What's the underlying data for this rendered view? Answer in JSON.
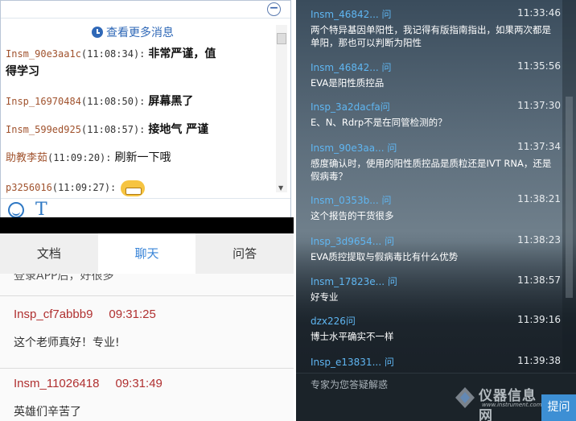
{
  "panel_a": {
    "more_messages": "查看更多消息",
    "messages": [
      {
        "user": "Insm_90e3aa1c",
        "time": "(11:08:34):",
        "text": "非常严谨，值",
        "text2": "得学习"
      },
      {
        "user": "Insp_16970484",
        "time": "(11:08:50):",
        "text": "屏幕黑了"
      },
      {
        "user": "Insm_599ed925",
        "time": "(11:08:57):",
        "text": "接地气 严谨"
      },
      {
        "user": "助教李茹",
        "time": "(11:09:20):",
        "text": "刷新一下哦"
      },
      {
        "user": "p3256016",
        "time": "(11:09:27):",
        "text": ""
      }
    ],
    "text_tool": "T",
    "collapse": "−"
  },
  "panel_b": {
    "tabs": [
      "文档",
      "聊天",
      "问答"
    ],
    "truncated_text": "登录APP后，好很多",
    "messages": [
      {
        "user": "Insp_cf7abbb9",
        "time": "09:31:25",
        "text": "这个老师真好！专业!"
      },
      {
        "user": "Insm_11026418",
        "time": "09:31:49",
        "text": "英雄们辛苦了"
      }
    ]
  },
  "panel_c": {
    "messages": [
      {
        "user": "Insm_46842... 问",
        "time": "11:33:46",
        "text": "两个特异基因单阳性，我记得有版指南指出，如果两次都是单阳，那也可以判断为阳性"
      },
      {
        "user": "Insm_46842... 问",
        "time": "11:35:56",
        "text": "EVA是阳性质控品"
      },
      {
        "user": "Insp_3a2dacfa问",
        "time": "11:37:30",
        "text": "E、N、Rdrp不是在同管检测的？"
      },
      {
        "user": "Insm_90e3aa... 问",
        "time": "11:37:34",
        "text": "感度确认时，使用的阳性质控品是质粒还是IVT RNA，还是假病毒？"
      },
      {
        "user": "Insm_0353b... 问",
        "time": "11:38:21",
        "text": "这个报告的干货很多"
      },
      {
        "user": "Insp_3d9654... 问",
        "time": "11:38:23",
        "text": "EVA质控提取与假病毒比有什么优势"
      },
      {
        "user": "Insm_17823e... 问",
        "time": "11:38:57",
        "text": "好专业"
      },
      {
        "user": "dzx226问",
        "time": "11:39:16",
        "text": "博士水平确实不一样"
      },
      {
        "user": "Insp_e13831... 问",
        "time": "11:39:38",
        "text": ""
      }
    ],
    "ask_placeholder": "专家为您答疑解惑",
    "ask_button": "提问",
    "watermark_cn": "仪器信息网",
    "watermark_en": "www.instrument.com.cn"
  }
}
